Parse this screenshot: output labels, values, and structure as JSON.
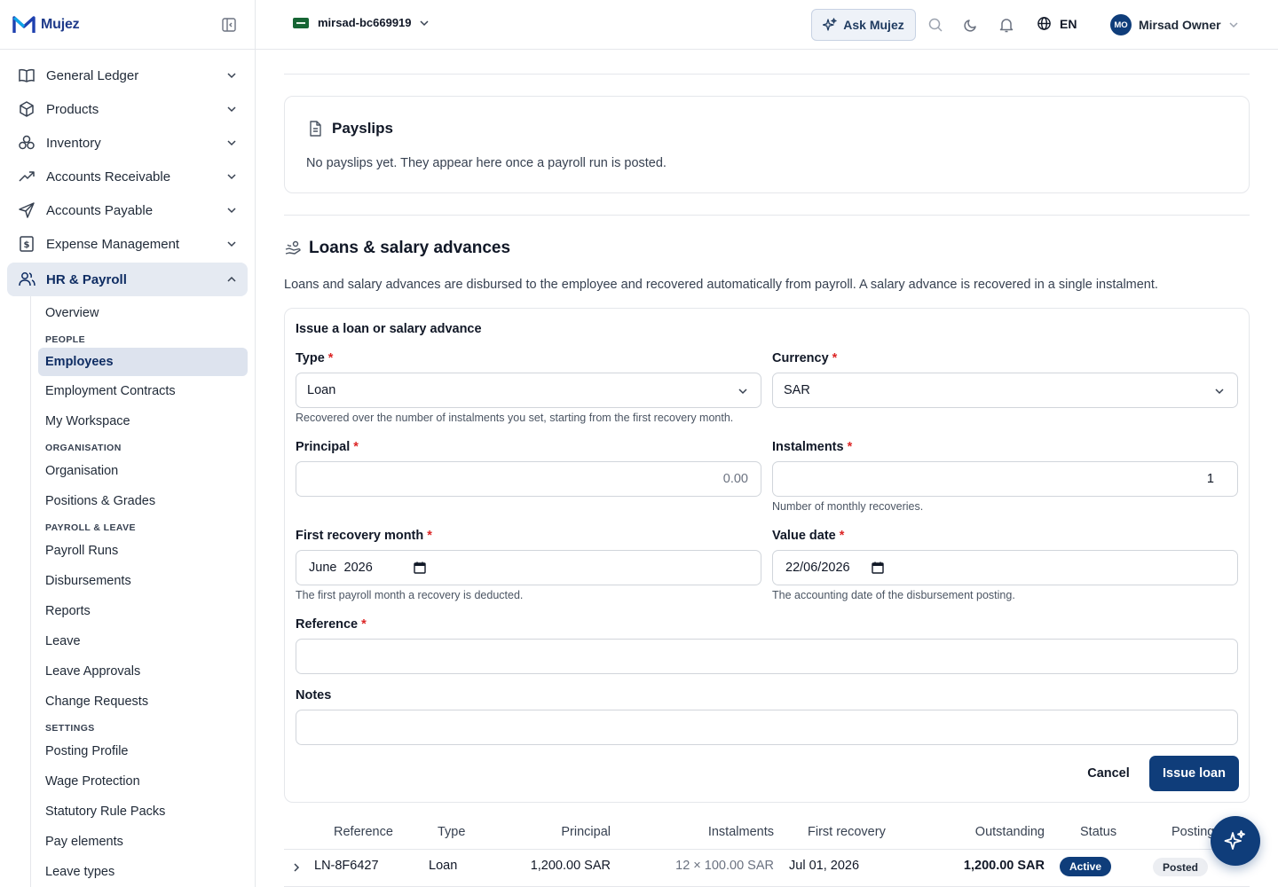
{
  "brand": {
    "name": "Mujez"
  },
  "topbar": {
    "org_name": "mirsad-bc669919",
    "ask_label": "Ask Mujez",
    "language": "EN",
    "user_initials": "MO",
    "user_name": "Mirsad Owner"
  },
  "sidebar": {
    "items": [
      {
        "label": "General Ledger",
        "icon": "book-open-icon"
      },
      {
        "label": "Products",
        "icon": "box-icon"
      },
      {
        "label": "Inventory",
        "icon": "boxes-icon"
      },
      {
        "label": "Accounts Receivable",
        "icon": "trending-up-icon"
      },
      {
        "label": "Accounts Payable",
        "icon": "send-icon"
      },
      {
        "label": "Expense Management",
        "icon": "receipt-icon"
      },
      {
        "label": "HR & Payroll",
        "icon": "users-icon"
      }
    ],
    "hr_sub": {
      "overview": "Overview",
      "people_head": "PEOPLE",
      "employees": "Employees",
      "employment_contracts": "Employment Contracts",
      "my_workspace": "My Workspace",
      "organisation_head": "ORGANISATION",
      "organisation": "Organisation",
      "positions_grades": "Positions & Grades",
      "payroll_leave_head": "PAYROLL & LEAVE",
      "payroll_runs": "Payroll Runs",
      "disbursements": "Disbursements",
      "reports": "Reports",
      "leave": "Leave",
      "leave_approvals": "Leave Approvals",
      "change_requests": "Change Requests",
      "settings_head": "SETTINGS",
      "posting_profile": "Posting Profile",
      "wage_protection": "Wage Protection",
      "statutory_rule_packs": "Statutory Rule Packs",
      "pay_elements": "Pay elements",
      "leave_types": "Leave types"
    }
  },
  "payslips": {
    "title": "Payslips",
    "empty_text": "No payslips yet. They appear here once a payroll run is posted."
  },
  "loans": {
    "title": "Loans & salary advances",
    "description": "Loans and salary advances are disbursed to the employee and recovered automatically from payroll. A salary advance is recovered in a single instalment.",
    "form": {
      "title": "Issue a loan or salary advance",
      "type_label": "Type",
      "type_value": "Loan",
      "type_hint": "Recovered over the number of instalments you set, starting from the first recovery month.",
      "currency_label": "Currency",
      "currency_value": "SAR",
      "principal_label": "Principal",
      "principal_placeholder": "0.00",
      "instalments_label": "Instalments",
      "instalments_value": "1",
      "instalments_hint": "Number of monthly recoveries.",
      "first_recovery_label": "First recovery month",
      "first_recovery_value": "June  2026",
      "first_recovery_hint": "The first payroll month a recovery is deducted.",
      "value_date_label": "Value date",
      "value_date_value": "22/06/2026",
      "value_date_hint": "The accounting date of the disbursement posting.",
      "reference_label": "Reference",
      "notes_label": "Notes",
      "required_mark": "*",
      "cancel_label": "Cancel",
      "issue_label": "Issue loan"
    },
    "table": {
      "headers": [
        "Reference",
        "Type",
        "Principal",
        "Instalments",
        "First recovery",
        "Outstanding",
        "Status",
        "Posting"
      ],
      "rows": [
        {
          "reference": "LN-8F6427",
          "type": "Loan",
          "principal": "1,200.00 SAR",
          "instalments": "12 × 100.00 SAR",
          "first_recovery": "Jul 01, 2026",
          "outstanding": "1,200.00 SAR",
          "status": "Active",
          "posting": "Posted"
        }
      ]
    }
  },
  "colors": {
    "primary": "#0f3d7a",
    "required": "#dc2626",
    "active_bg": "#e5eaf2"
  }
}
